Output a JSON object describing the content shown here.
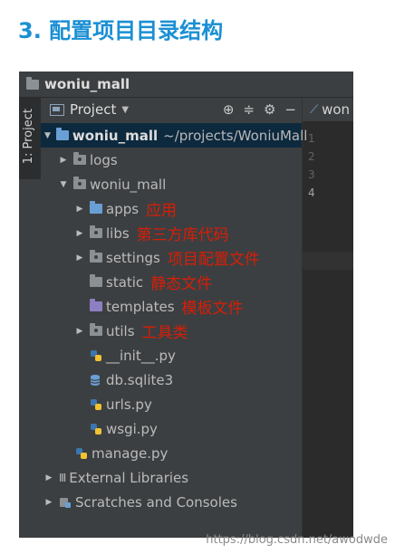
{
  "heading": "3. 配置项目目录结构",
  "window": {
    "title": "woniu_mall"
  },
  "sidestrip": {
    "label": "1: Project"
  },
  "panel": {
    "title": "Project"
  },
  "editor": {
    "tab": "won",
    "line_numbers": [
      "1",
      "2",
      "3",
      "4"
    ]
  },
  "tree": {
    "root": {
      "name": "woniu_mall",
      "path": "~/projects/WoniuMall"
    },
    "logs": "logs",
    "pkg": "woniu_mall",
    "apps": {
      "name": "apps",
      "note": "应用"
    },
    "libs": {
      "name": "libs",
      "note": "第三方库代码"
    },
    "settings": {
      "name": "settings",
      "note": "项目配置文件"
    },
    "static": {
      "name": "static",
      "note": "静态文件"
    },
    "templates": {
      "name": "templates",
      "note": "模板文件"
    },
    "utils": {
      "name": "utils",
      "note": "工具类"
    },
    "init": "__init__.py",
    "db": "db.sqlite3",
    "urls": "urls.py",
    "wsgi": "wsgi.py",
    "manage": "manage.py",
    "ext": "External Libraries",
    "scratch": "Scratches and Consoles"
  },
  "watermark": "https://blog.csdn.net/awodwde",
  "colors": {
    "heading": "#1a8fd3",
    "annotation": "#d81e06",
    "ide_bg": "#3c3f41",
    "editor_bg": "#2b2b2b",
    "selected": "#0d293e"
  }
}
